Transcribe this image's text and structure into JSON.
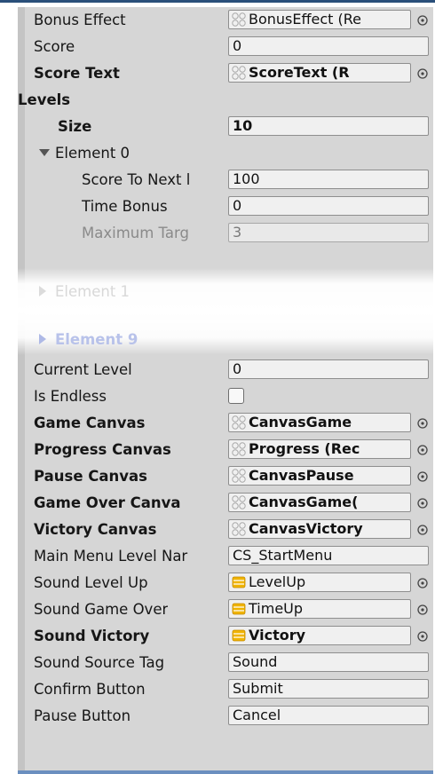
{
  "colors": {
    "panel_bg": "#d6d6d6",
    "field_bg": "#f0f0f0",
    "top_line": "#2a4f7a",
    "element9_blue": "#b8c2ea",
    "audio_icon": "#f0b400"
  },
  "rows": {
    "bonus_effect": {
      "label": "Bonus Effect",
      "value": "BonusEffect (Re",
      "icon": "gameobject-icon"
    },
    "score": {
      "label": "Score",
      "value": "0"
    },
    "score_text": {
      "label": "Score Text",
      "value": "ScoreText (R",
      "icon": "gameobject-icon"
    },
    "levels": {
      "label": "Levels"
    },
    "size": {
      "label": "Size",
      "value": "10"
    },
    "element0": {
      "label": "Element 0"
    },
    "score_to_next": {
      "label": "Score To Next l",
      "value": "100"
    },
    "time_bonus": {
      "label": "Time Bonus",
      "value": "0"
    },
    "max_targets": {
      "label": "Maximum Targ",
      "value": "3"
    },
    "element1": {
      "label": "Element 1"
    },
    "element9": {
      "label": "Element 9"
    },
    "current_level": {
      "label": "Current Level",
      "value": "0"
    },
    "is_endless": {
      "label": "Is Endless",
      "checked": false
    },
    "game_canvas": {
      "label": "Game Canvas",
      "value": "CanvasGame",
      "icon": "gameobject-icon"
    },
    "progress_canvas": {
      "label": "Progress Canvas",
      "value": "Progress (Rec",
      "icon": "gameobject-icon"
    },
    "pause_canvas": {
      "label": "Pause Canvas",
      "value": "CanvasPause",
      "icon": "gameobject-icon"
    },
    "game_over_canvas": {
      "label": "Game Over Canva",
      "value": "CanvasGame(",
      "icon": "gameobject-icon"
    },
    "victory_canvas": {
      "label": "Victory Canvas",
      "value": "CanvasVictory",
      "icon": "gameobject-icon"
    },
    "main_menu_level": {
      "label": "Main Menu Level Nar",
      "value": "CS_StartMenu"
    },
    "sound_level_up": {
      "label": "Sound Level Up",
      "value": "LevelUp",
      "icon": "audioclip-icon"
    },
    "sound_game_over": {
      "label": "Sound Game Over",
      "value": "TimeUp",
      "icon": "audioclip-icon"
    },
    "sound_victory": {
      "label": "Sound Victory",
      "value": "Victory",
      "icon": "audioclip-icon"
    },
    "sound_source_tag": {
      "label": "Sound Source Tag",
      "value": "Sound"
    },
    "confirm_button": {
      "label": "Confirm Button",
      "value": "Submit"
    },
    "pause_button": {
      "label": "Pause Button",
      "value": "Cancel"
    }
  }
}
